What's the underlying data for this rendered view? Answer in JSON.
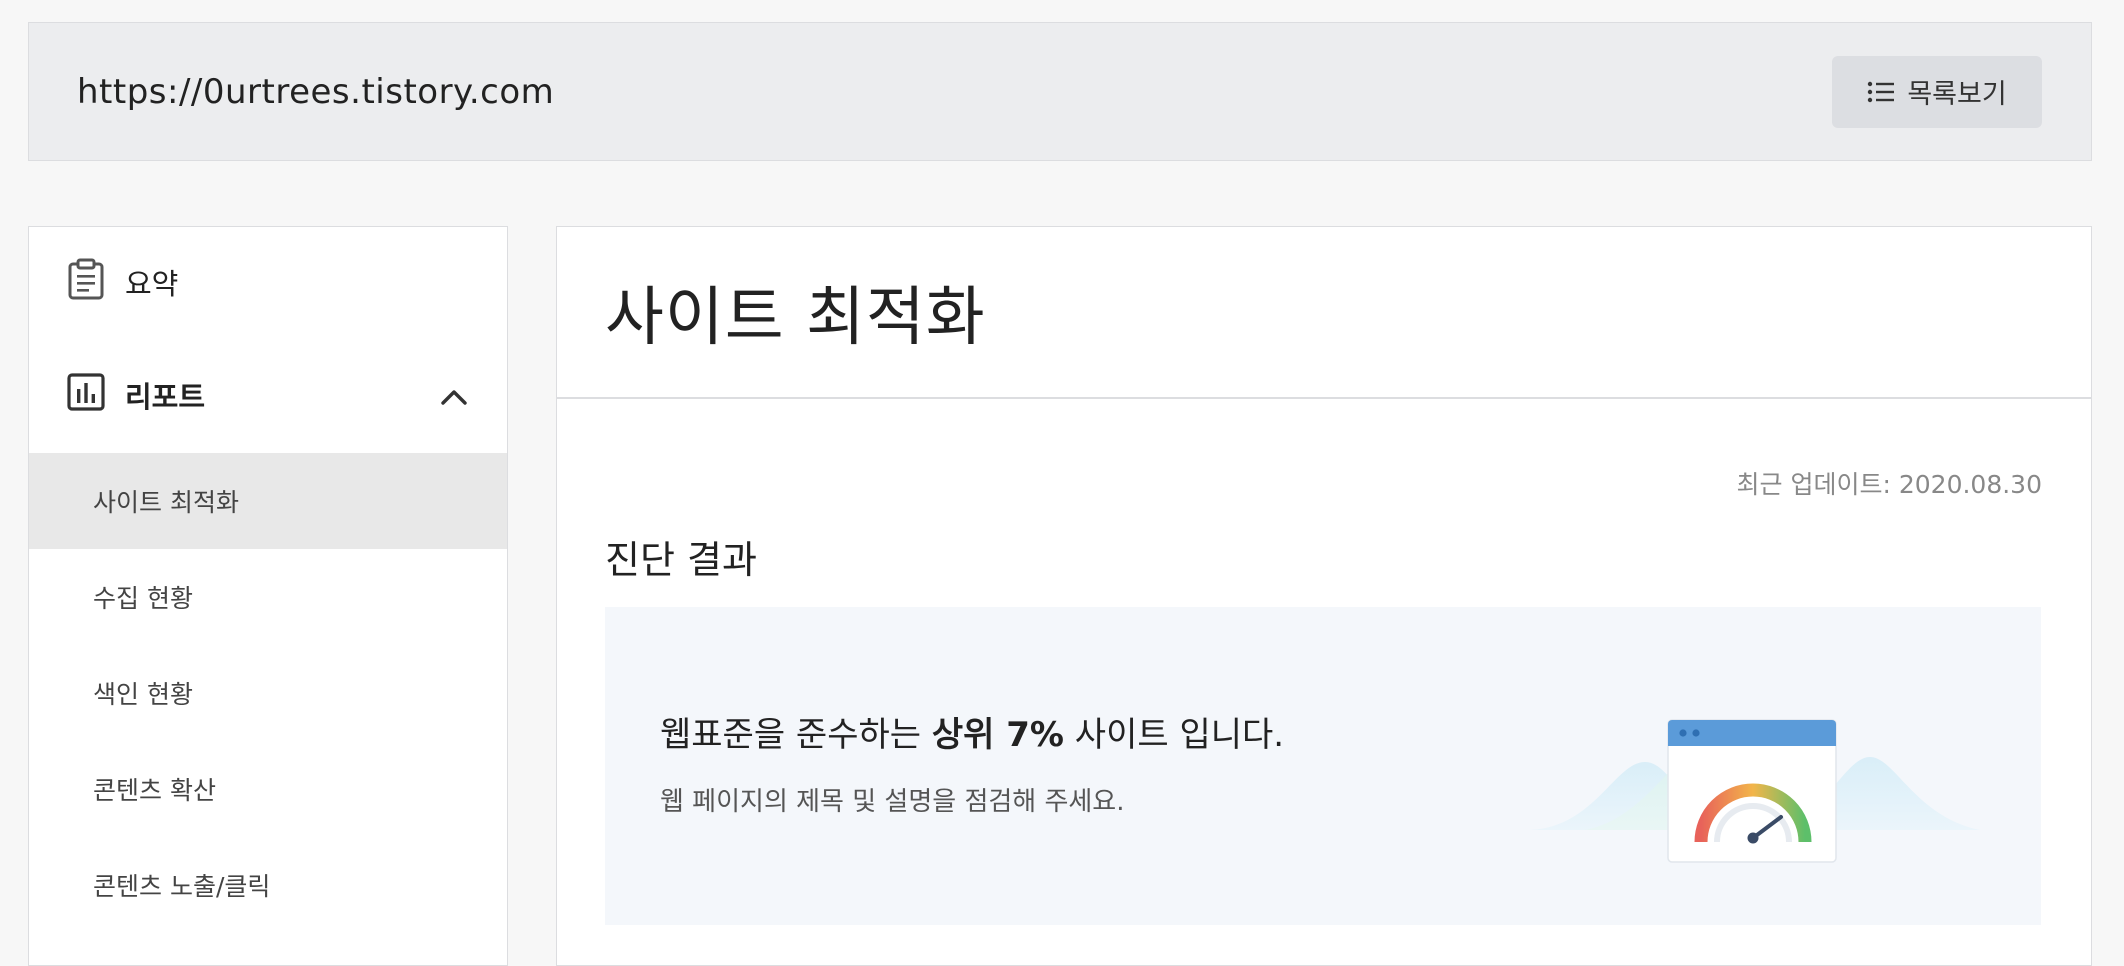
{
  "header": {
    "url": "https://0urtrees.tistory.com",
    "list_button_label": "목록보기",
    "list_button_icon": "list-icon"
  },
  "sidebar": {
    "summary": {
      "label": "요약",
      "icon": "clipboard-icon"
    },
    "report": {
      "label": "리포트",
      "icon": "bar-chart-icon",
      "expanded": true
    },
    "sub_items": [
      {
        "label": "사이트 최적화",
        "active": true
      },
      {
        "label": "수집 현황",
        "active": false
      },
      {
        "label": "색인 현황",
        "active": false
      },
      {
        "label": "콘텐츠 확산",
        "active": false
      },
      {
        "label": "콘텐츠 노출/클릭",
        "active": false
      }
    ]
  },
  "main": {
    "title": "사이트 최적화",
    "updated": "최근 업데이트: 2020.08.30",
    "section_title": "진단 결과",
    "result": {
      "prefix": "웹표준을 준수하는 ",
      "highlight": "상위 7%",
      "suffix": " 사이트 입니다.",
      "sub": "웹 페이지의 제목 및 설명을 점검해 주세요."
    }
  },
  "colors": {
    "topbar_bg": "#ecedef",
    "active_item_bg": "#e8e8e8",
    "result_bg": "#f4f7fb",
    "gauge_header": "#5b9bd9"
  }
}
